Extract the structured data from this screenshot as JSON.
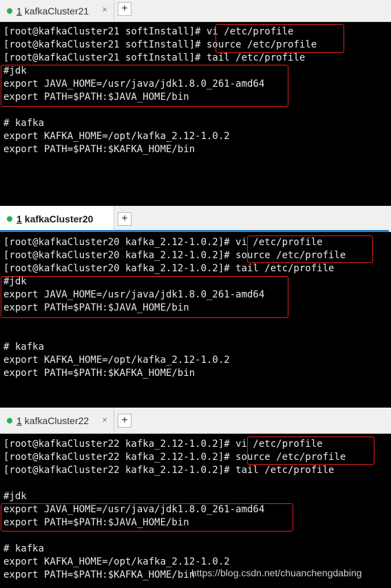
{
  "panels": [
    {
      "tab": {
        "number": "1",
        "title": "kafkaCluster21",
        "close": "×",
        "status": "connected",
        "active": false
      },
      "lines": [
        "[root@kafkaCluster21 softInstall]# vi /etc/profile",
        "[root@kafkaCluster21 softInstall]# source /etc/profile",
        "[root@kafkaCluster21 softInstall]# tail /etc/profile",
        "#jdk",
        "export JAVA_HOME=/usr/java/jdk1.8.0_261-amd64",
        "export PATH=$PATH:$JAVA_HOME/bin",
        "",
        "# kafka",
        "export KAFKA_HOME=/opt/kafka_2.12-1.0.2",
        "export PATH=$PATH:$KAFKA_HOME/bin"
      ]
    },
    {
      "tab": {
        "number": "1",
        "title": "kafkaCluster20",
        "close": "",
        "status": "connected",
        "active": true
      },
      "lines": [
        "[root@kafkaCluster20 kafka_2.12-1.0.2]# vi /etc/profile",
        "[root@kafkaCluster20 kafka_2.12-1.0.2]# source /etc/profile",
        "[root@kafkaCluster20 kafka_2.12-1.0.2]# tail /etc/profile",
        "#jdk",
        "export JAVA_HOME=/usr/java/jdk1.8.0_261-amd64",
        "export PATH=$PATH:$JAVA_HOME/bin",
        "",
        "",
        "# kafka",
        "export KAFKA_HOME=/opt/kafka_2.12-1.0.2",
        "export PATH=$PATH:$KAFKA_HOME/bin"
      ]
    },
    {
      "tab": {
        "number": "1",
        "title": "kafkaCluster22",
        "close": "×",
        "status": "connected",
        "active": false
      },
      "lines": [
        "[root@kafkaCluster22 kafka_2.12-1.0.2]# vi /etc/profile",
        "[root@kafkaCluster22 kafka_2.12-1.0.2]# source /etc/profile",
        "[root@kafkaCluster22 kafka_2.12-1.0.2]# tail /etc/profile",
        "",
        "#jdk",
        "export JAVA_HOME=/usr/java/jdk1.8.0_261-amd64",
        "export PATH=$PATH:$JAVA_HOME/bin",
        "",
        "# kafka",
        "export KAFKA_HOME=/opt/kafka_2.12-1.0.2",
        "export PATH=$PATH:$KAFKA_HOME/bin"
      ]
    }
  ],
  "new_tab_label": "+",
  "watermark": "https://blog.csdn.net/chuanchengdabing",
  "colors": {
    "highlight": "#e02020",
    "status_dot": "#22b24c",
    "active_accent": "#2f7fc4",
    "terminal_bg": "#000000",
    "terminal_fg": "#e8e8e8"
  },
  "icons": {
    "status": "connected-dot-icon",
    "close": "close-icon",
    "new_tab": "plus-icon"
  }
}
